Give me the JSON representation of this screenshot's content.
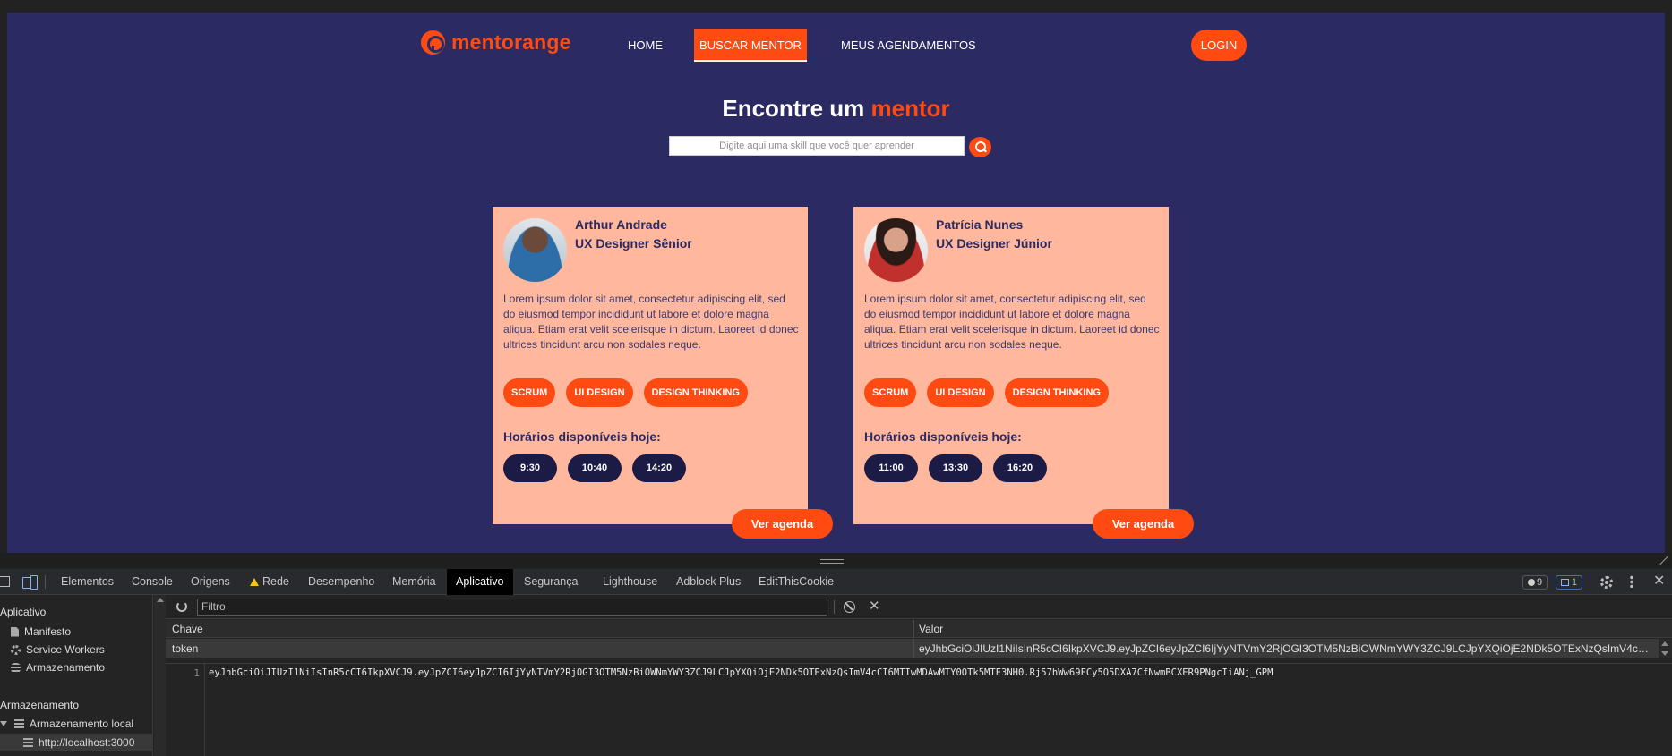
{
  "app": {
    "logo_text": "mentorange",
    "nav": {
      "home": "HOME",
      "buscar": "BUSCAR MENTOR",
      "meus": "MEUS AGENDAMENTOS",
      "login": "LOGIN"
    },
    "headline_start": "Encontre um",
    "headline_accent": "mentor",
    "search_placeholder": "Digite aqui uma skill que você quer aprender",
    "mentors": [
      {
        "name": "Arthur Andrade",
        "role": "UX Designer Sênior",
        "description": "Lorem ipsum dolor sit amet, consectetur adipiscing elit, sed do eiusmod tempor incididunt ut labore et dolore magna aliqua. Etiam erat velit scelerisque in dictum. Laoreet id donec ultrices tincidunt arcu non sodales neque.",
        "tags": [
          "SCRUM",
          "UI DESIGN",
          "DESIGN THINKING"
        ],
        "availability_title": "Horários disponíveis hoje:",
        "times": [
          "9:30",
          "10:40",
          "14:20"
        ],
        "cta": "Ver agenda"
      },
      {
        "name": "Patrícia Nunes",
        "role": "UX Designer Júnior",
        "description": "Lorem ipsum dolor sit amet, consectetur adipiscing elit, sed do eiusmod tempor incididunt ut labore et dolore magna aliqua. Etiam erat velit scelerisque in dictum. Laoreet id donec ultrices tincidunt arcu non sodales neque.",
        "tags": [
          "SCRUM",
          "UI DESIGN",
          "DESIGN THINKING"
        ],
        "availability_title": "Horários disponíveis hoje:",
        "times": [
          "11:00",
          "13:30",
          "16:20"
        ],
        "cta": "Ver agenda"
      }
    ],
    "colors": {
      "accent": "#ff4a12",
      "background": "#2b2a63",
      "card": "#ffb89d",
      "time_pill": "#1c1b45"
    }
  },
  "devtools": {
    "tabs": [
      "Elementos",
      "Console",
      "Origens",
      "Rede",
      "Desempenho",
      "Memória",
      "Aplicativo",
      "Segurança",
      "Lighthouse",
      "Adblock Plus",
      "EditThisCookie"
    ],
    "active_tab": "Aplicativo",
    "issues_count": "9",
    "messages_count": "1",
    "sidebar": {
      "section1": "Aplicativo",
      "section1_items": [
        "Manifesto",
        "Service Workers",
        "Armazenamento"
      ],
      "section2": "Armazenamento",
      "local_storage": "Armazenamento local",
      "origin": "http://localhost:3000"
    },
    "filter_placeholder": "Filtro",
    "columns": {
      "key": "Chave",
      "value": "Valor"
    },
    "rows": [
      {
        "key": "token",
        "value": "eyJhbGciOiJIUzI1NiIsInR5cCI6IkpXVCJ9.eyJpZCI6eyJpZCI6IjYyNTVmY2RjOGI3OTM5NzBiOWNmYWY3ZCJ9LCJpYXQiOjE2NDk5OTExNzQsImV4cCI6MTIwMDAwMTY0OTk5MTE3NH0.Rj57hWw69FCy5O5DXA7CfNwmBCXER9PNgcIiANj_GPM"
      }
    ],
    "preview_line_no": "1",
    "preview_text": "eyJhbGciOiJIUzI1NiIsInR5cCI6IkpXVCJ9.eyJpZCI6eyJpZCI6IjYyNTVmY2RjOGI3OTM5NzBiOWNmYWY3ZCJ9LCJpYXQiOjE2NDk5OTExNzQsImV4cCI6MTIwMDAwMTY0OTk5MTE3NH0.Rj57hWw69FCy5O5DXA7CfNwmBCXER9PNgcIiANj_GPM"
  }
}
